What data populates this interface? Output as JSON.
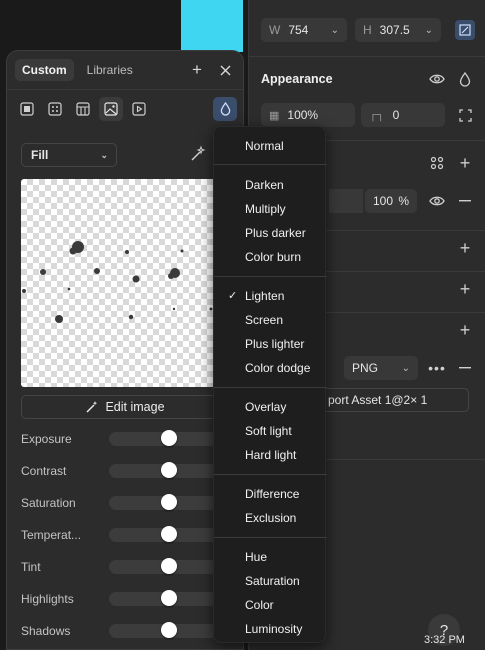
{
  "right_panel": {
    "width_field": {
      "label": "W",
      "value": "754"
    },
    "height_field": {
      "label": "H",
      "value": "307.5"
    },
    "appearance": {
      "title": "Appearance",
      "opacity_value": "100%",
      "radius_value": "0"
    },
    "fill_layer": {
      "opacity": "100",
      "unit": "%"
    },
    "export": {
      "format": "PNG",
      "filename": "port Asset 1@2× 1"
    }
  },
  "fill_panel": {
    "tabs": [
      {
        "label": "Custom"
      },
      {
        "label": "Libraries"
      }
    ],
    "fill_mode": "Fill",
    "edit_image_label": "Edit image",
    "adjustments": [
      {
        "label": "Exposure",
        "value": 0.5
      },
      {
        "label": "Contrast",
        "value": 0.5
      },
      {
        "label": "Saturation",
        "value": 0.5
      },
      {
        "label": "Temperat...",
        "value": 0.5
      },
      {
        "label": "Tint",
        "value": 0.5
      },
      {
        "label": "Highlights",
        "value": 0.5
      },
      {
        "label": "Shadows",
        "value": 0.5
      }
    ]
  },
  "blend_menu": {
    "groups": [
      [
        "Normal"
      ],
      [
        "Darken",
        "Multiply",
        "Plus darker",
        "Color burn"
      ],
      [
        "Lighten",
        "Screen",
        "Plus lighter",
        "Color dodge"
      ],
      [
        "Overlay",
        "Soft light",
        "Hard light"
      ],
      [
        "Difference",
        "Exclusion"
      ],
      [
        "Hue",
        "Saturation",
        "Color",
        "Luminosity"
      ]
    ],
    "selected": "Lighten"
  },
  "taskbar": {
    "clock": "3:32 PM",
    "help_label": "?"
  },
  "colors": {
    "panel_bg": "#2c2c2c",
    "menu_bg": "#1e1e1e",
    "accent_blue": "#3a4d6a",
    "canvas_shape": "#3fd6f2"
  }
}
